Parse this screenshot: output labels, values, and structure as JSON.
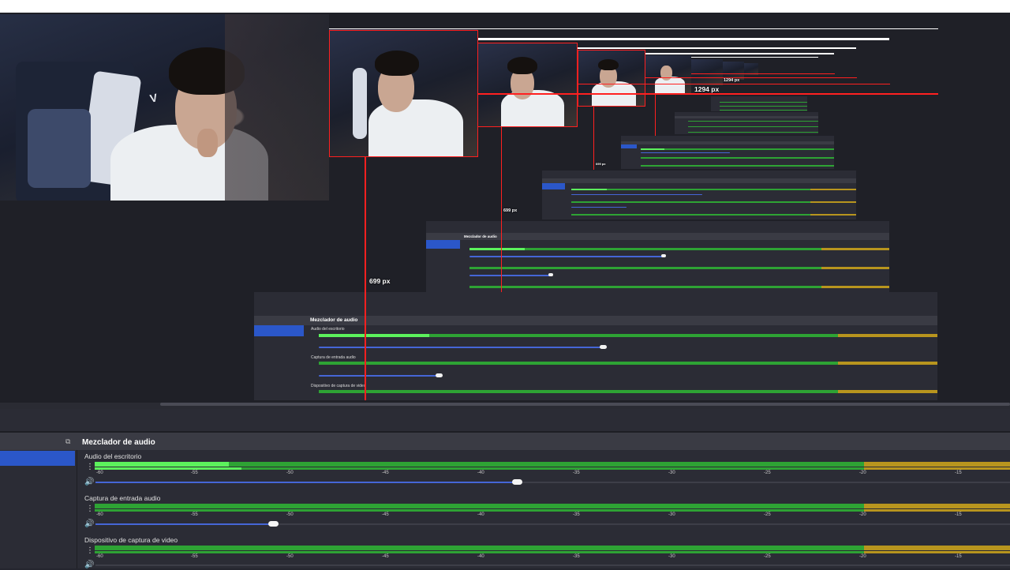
{
  "mixer": {
    "title": "Mezclador de audio",
    "dock_icon": "dock-float-icon",
    "channels": [
      {
        "name": "Audio del escritorio",
        "level": 0.16,
        "volume": 0.46
      },
      {
        "name": "Captura de entrada audio",
        "level": 0.0,
        "volume": 0.19
      },
      {
        "name": "Dispositivo de captura de video",
        "level": 0.0,
        "volume": 0.0
      }
    ],
    "ticks": [
      "-60",
      "-55",
      "-50",
      "-45",
      "-40",
      "-35",
      "-30",
      "-25",
      "-20",
      "-15"
    ]
  },
  "labels": {
    "px_699": "699 px",
    "px_1294": "1294 px"
  },
  "icons": {
    "menu": "vertical-dots-icon",
    "speaker": "speaker-icon"
  },
  "colors": {
    "meter_green": "#2ea334",
    "meter_level": "#5cf25c",
    "meter_warn": "#b8951e",
    "fader": "#4566d6",
    "selection": "#2b57c9",
    "guide_red": "#ff2020"
  }
}
